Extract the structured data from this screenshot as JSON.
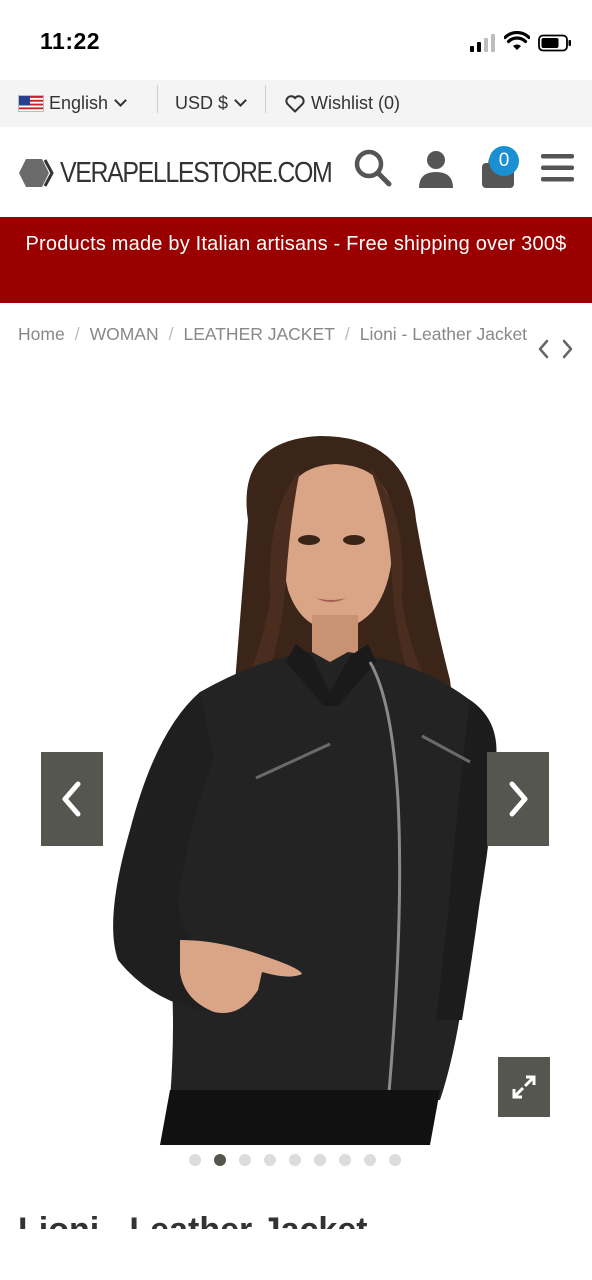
{
  "status_bar": {
    "time": "11:22"
  },
  "util_bar": {
    "language": "English",
    "currency": "USD $",
    "wishlist": "Wishlist (0)"
  },
  "header": {
    "logo_text": "VERAPELLESTORE.COM",
    "cart_count": "0",
    "icons": [
      "search-icon",
      "user-icon",
      "cart-icon",
      "menu-icon"
    ]
  },
  "promo": {
    "text": "Products made by Italian artisans - Free shipping over 300$"
  },
  "breadcrumb": {
    "items": [
      "Home",
      "WOMAN",
      "LEATHER JACKET",
      "Lioni - Leather Jacket"
    ]
  },
  "gallery": {
    "image_count": 9,
    "active_index": 1
  },
  "product": {
    "title": "Lioni - Leather Jacket"
  },
  "colors": {
    "promo_bg": "#9a0000",
    "badge": "#1a8fd1",
    "gallery_buttons": "#55564f"
  }
}
